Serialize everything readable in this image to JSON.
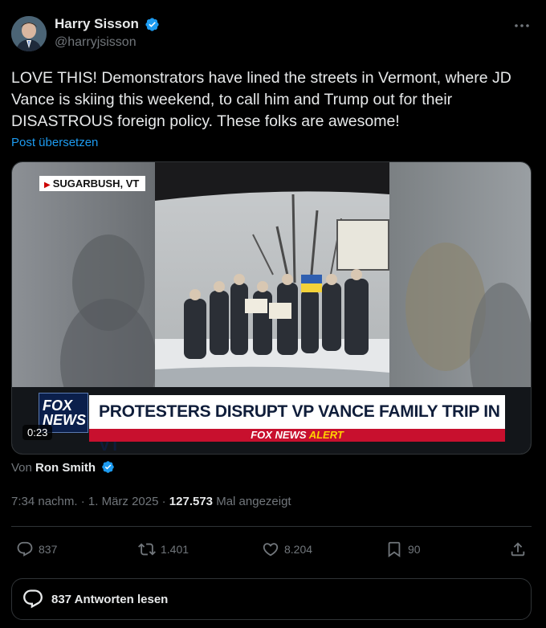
{
  "author": {
    "display_name": "Harry Sisson",
    "handle": "@harryjsisson",
    "verified": true
  },
  "tweet": {
    "text": "LOVE THIS! Demonstrators have lined the streets in Vermont, where JD Vance is skiing this weekend, to call him and Trump out for their DISASTROUS foreign policy. These folks are awesome!",
    "translate_label": "Post übersetzen"
  },
  "media": {
    "location_tag": "SUGARBUSH, VT",
    "network_logo_line1": "FOX",
    "network_logo_line2": "NEWS",
    "headline": "PROTESTERS DISRUPT VP VANCE FAMILY TRIP IN VT",
    "alert_prefix": "FOX NEWS",
    "alert_word": "ALERT",
    "duration": "0:23"
  },
  "byline": {
    "prefix": "Von",
    "name": "Ron Smith",
    "verified": true
  },
  "meta": {
    "time": "7:34 nachm.",
    "separator": " · ",
    "date": "1. März 2025",
    "views": "127.573",
    "views_label": "Mal angezeigt"
  },
  "actions": {
    "replies": "837",
    "reposts": "1.401",
    "likes": "8.204",
    "bookmarks": "90"
  },
  "read_replies": {
    "label": "837 Antworten lesen"
  },
  "colors": {
    "accent": "#1d9bf0",
    "muted": "#71767b",
    "text": "#e7e9ea",
    "border": "#2f3336"
  }
}
